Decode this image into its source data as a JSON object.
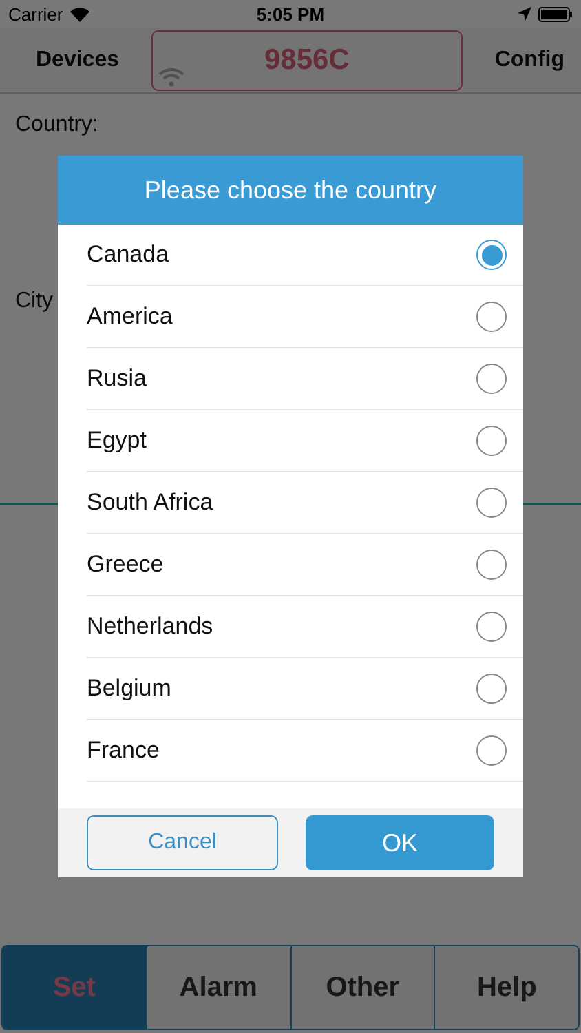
{
  "status_bar": {
    "carrier": "Carrier",
    "time": "5:05 PM"
  },
  "nav_bar": {
    "left": "Devices",
    "device": "9856C",
    "right": "Config"
  },
  "form": {
    "labels": [
      "Country:",
      "City"
    ]
  },
  "dialog": {
    "title": "Please choose the country",
    "options": [
      {
        "label": "Canada",
        "selected": true
      },
      {
        "label": "America",
        "selected": false
      },
      {
        "label": "Rusia",
        "selected": false
      },
      {
        "label": "Egypt",
        "selected": false
      },
      {
        "label": "South Africa",
        "selected": false
      },
      {
        "label": "Greece",
        "selected": false
      },
      {
        "label": "Netherlands",
        "selected": false
      },
      {
        "label": "Belgium",
        "selected": false
      },
      {
        "label": "France",
        "selected": false
      }
    ],
    "buttons": [
      {
        "label": "Cancel",
        "kind": "secondary"
      },
      {
        "label": "OK",
        "kind": "primary"
      }
    ]
  },
  "tab_bar": [
    {
      "label": "Set",
      "selected": true
    },
    {
      "label": "Alarm",
      "selected": false
    },
    {
      "label": "Other",
      "selected": false
    },
    {
      "label": "Help",
      "selected": false
    }
  ]
}
